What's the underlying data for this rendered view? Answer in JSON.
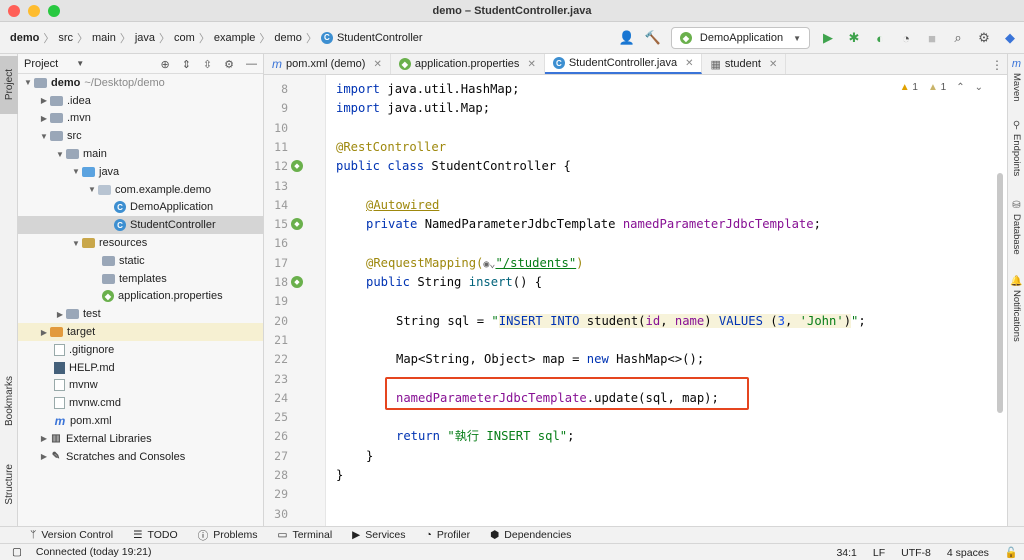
{
  "window": {
    "title": "demo – StudentController.java"
  },
  "breadcrumbs": [
    "demo",
    "src",
    "main",
    "java",
    "com",
    "example",
    "demo",
    "StudentController"
  ],
  "toolbar": {
    "run_config": "DemoApplication"
  },
  "left_strip": {
    "project": "Project",
    "bookmarks": "Bookmarks",
    "structure": "Structure"
  },
  "project_panel": {
    "title": "Project"
  },
  "tree": [
    {
      "label": "demo",
      "extra": "~/Desktop/demo"
    },
    {
      "label": ".idea"
    },
    {
      "label": ".mvn"
    },
    {
      "label": "src"
    },
    {
      "label": "main"
    },
    {
      "label": "java"
    },
    {
      "label": "com.example.demo"
    },
    {
      "label": "DemoApplication"
    },
    {
      "label": "StudentController"
    },
    {
      "label": "resources"
    },
    {
      "label": "static"
    },
    {
      "label": "templates"
    },
    {
      "label": "application.properties"
    },
    {
      "label": "test"
    },
    {
      "label": "target"
    },
    {
      "label": ".gitignore"
    },
    {
      "label": "HELP.md"
    },
    {
      "label": "mvnw"
    },
    {
      "label": "mvnw.cmd"
    },
    {
      "label": "pom.xml"
    },
    {
      "label": "External Libraries"
    },
    {
      "label": "Scratches and Consoles"
    }
  ],
  "editor_tabs": [
    {
      "label": "pom.xml (demo)"
    },
    {
      "label": "application.properties"
    },
    {
      "label": "StudentController.java"
    },
    {
      "label": "student"
    }
  ],
  "inspections": {
    "warnings": "1",
    "weak": "1"
  },
  "line_numbers": [
    "8",
    "9",
    "10",
    "11",
    "12",
    "13",
    "14",
    "15",
    "16",
    "17",
    "18",
    "19",
    "20",
    "21",
    "22",
    "23",
    "24",
    "25",
    "26",
    "27",
    "28",
    "29",
    "30"
  ],
  "code": {
    "l8_kw": "import",
    "l8_rest": " java.util.HashMap;",
    "l9_kw": "import",
    "l9_rest": " java.util.Map;",
    "l11": "@RestController",
    "l12_kw": "public class",
    "l12_rest": " StudentController {",
    "l14": "@Autowired",
    "l15_kw": "private",
    "l15_type": " NamedParameterJdbcTemplate ",
    "l15_field": "namedParameterJdbcTemplate",
    "l15_end": ";",
    "l17_an": "@RequestMapping(",
    "l17_str": "\"/students\"",
    "l17_end": ")",
    "l18_kw": "public",
    "l18_type": " String ",
    "l18_fn": "insert",
    "l18_end": "() {",
    "l20_a": "String sql = ",
    "l20_q1": "\"",
    "l20_sql1": "INSERT INTO",
    "l20_sql2": " student(",
    "l20_id": "id",
    "l20_c": ", ",
    "l20_name": "name",
    "l20_sql3": ") ",
    "l20_values": "VALUES",
    "l20_sql4": " (",
    "l20_num": "3",
    "l20_sql5": ", ",
    "l20_john": "'John'",
    "l20_sql6": ")",
    "l20_q2": "\"",
    "l20_end": ";",
    "l22_a": "Map<String, Object> map = ",
    "l22_kw": "new",
    "l22_b": " HashMap<>();",
    "l24_field": "namedParameterJdbcTemplate",
    "l24_rest": ".update(sql, map);",
    "l26_kw": "return",
    "l26_str": " \"執行 INSERT sql\"",
    "l26_end": ";",
    "l27": "}",
    "l28": "}"
  },
  "right_strip": {
    "maven": "Maven",
    "endpoints": "Endpoints",
    "database": "Database",
    "notifications": "Notifications"
  },
  "bottom_tabs": [
    "Version Control",
    "TODO",
    "Problems",
    "Terminal",
    "Services",
    "Profiler",
    "Dependencies"
  ],
  "status": {
    "message": "Connected (today 19:21)",
    "position": "34:1",
    "line_sep": "LF",
    "encoding": "UTF-8",
    "indent": "4 spaces"
  },
  "colors": {
    "accent": "#3a74d8",
    "highlight_box": "#e5451f",
    "keyword": "#0033b3",
    "annotation": "#9e880d",
    "field": "#871094",
    "string": "#067d17"
  }
}
